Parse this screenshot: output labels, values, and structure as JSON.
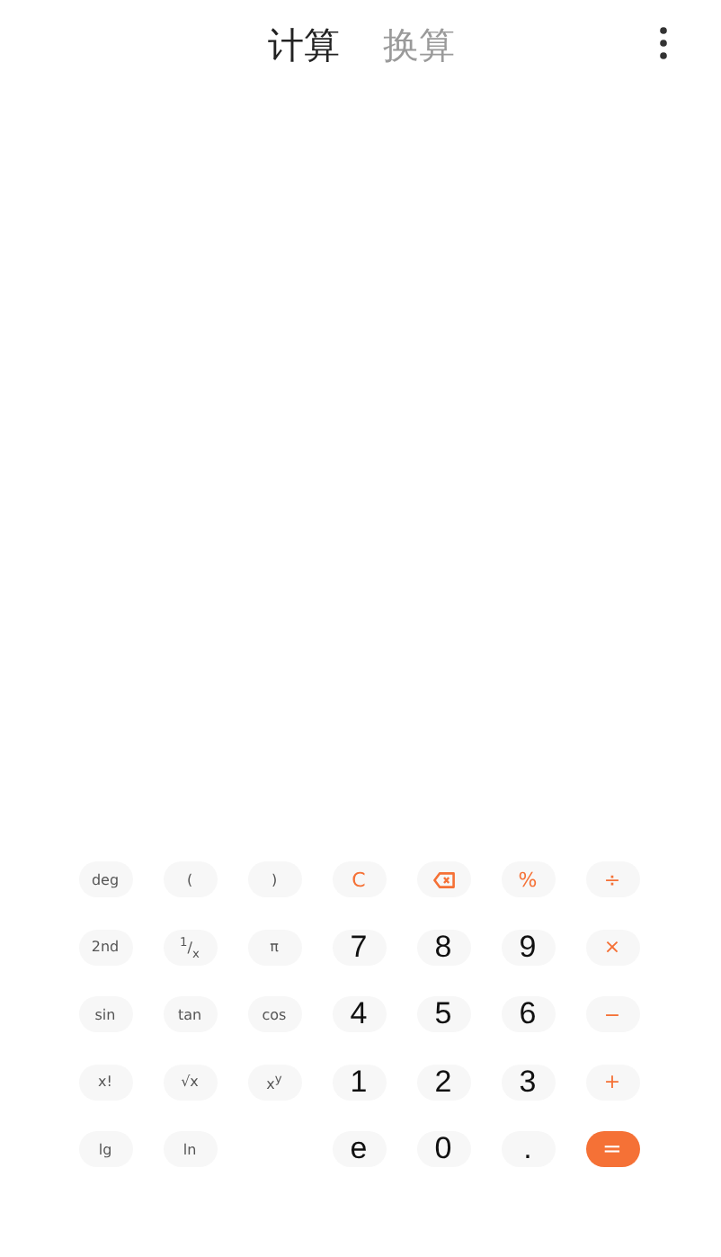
{
  "tabs": [
    {
      "label": "计算",
      "selected": true
    },
    {
      "label": "换算",
      "selected": false
    }
  ],
  "keys": [
    {
      "kind": "fn",
      "label": "deg"
    },
    {
      "kind": "fn",
      "label": "("
    },
    {
      "kind": "fn",
      "label": ")"
    },
    {
      "kind": "op",
      "label": "C"
    },
    {
      "kind": "backspace"
    },
    {
      "kind": "op",
      "label": "%"
    },
    {
      "kind": "op",
      "label": "÷"
    },
    {
      "kind": "fn",
      "label": "2nd"
    },
    {
      "kind": "fn",
      "label": "$^{1}$/$_{x}$"
    },
    {
      "kind": "fn",
      "label": "π"
    },
    {
      "kind": "digit",
      "label": "7"
    },
    {
      "kind": "digit",
      "label": "8"
    },
    {
      "kind": "digit",
      "label": "9"
    },
    {
      "kind": "op",
      "label": "×"
    },
    {
      "kind": "fn",
      "label": "sin"
    },
    {
      "kind": "fn",
      "label": "tan"
    },
    {
      "kind": "fn",
      "label": "cos"
    },
    {
      "kind": "digit",
      "label": "4"
    },
    {
      "kind": "digit",
      "label": "5"
    },
    {
      "kind": "digit",
      "label": "6"
    },
    {
      "kind": "op",
      "label": "−"
    },
    {
      "kind": "fn",
      "label": "x!"
    },
    {
      "kind": "fn",
      "label": "√x"
    },
    {
      "kind": "fn",
      "label": "x$^{y}$"
    },
    {
      "kind": "digit",
      "label": "1"
    },
    {
      "kind": "digit",
      "label": "2"
    },
    {
      "kind": "digit",
      "label": "3"
    },
    {
      "kind": "op",
      "label": "+"
    },
    {
      "kind": "fn",
      "label": "lg"
    },
    {
      "kind": "fn",
      "label": "ln"
    },
    {
      "kind": "blank"
    },
    {
      "kind": "digit",
      "label": "e"
    },
    {
      "kind": "digit",
      "label": "0"
    },
    {
      "kind": "digit",
      "label": "."
    },
    {
      "kind": "equals",
      "label": "="
    }
  ]
}
